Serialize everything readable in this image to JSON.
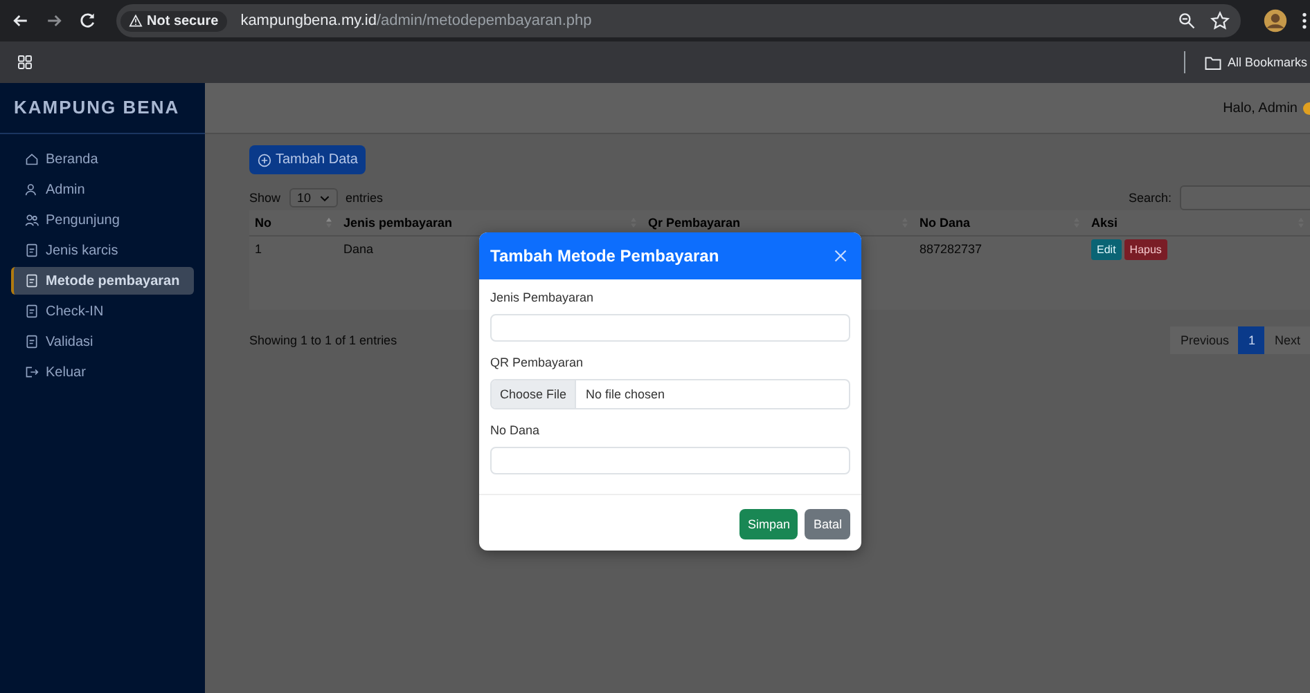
{
  "browser": {
    "security": "Not secure",
    "url_domain": "kampungbena.my.id",
    "url_path": "/admin/metodepembayaran.php",
    "bookmarks": "All Bookmarks"
  },
  "sidebar": {
    "brand": "KAMPUNG BENA",
    "items": [
      {
        "label": "Beranda",
        "selected": false
      },
      {
        "label": "Admin",
        "selected": false
      },
      {
        "label": "Pengunjung",
        "selected": false
      },
      {
        "label": "Jenis karcis",
        "selected": false
      },
      {
        "label": "Metode pembayaran",
        "selected": true
      },
      {
        "label": "Check-IN",
        "selected": false
      },
      {
        "label": "Validasi",
        "selected": false
      },
      {
        "label": "Keluar",
        "selected": false
      }
    ]
  },
  "header": {
    "greeting": "Halo, Admin"
  },
  "add_button": "Tambah Data",
  "table": {
    "show_label": "Show",
    "page_size": "10",
    "entries_label": "entries",
    "search_label": "Search:",
    "columns": [
      "No",
      "Jenis pembayaran",
      "Qr Pembayaran",
      "No Dana",
      "Aksi"
    ],
    "rows": [
      {
        "no": "1",
        "jenis": "Dana",
        "no_dana": "887282737",
        "actions": [
          {
            "label": "Edit",
            "kind": "edit"
          },
          {
            "label": "Hapus",
            "kind": "delete"
          }
        ]
      }
    ],
    "info": "Showing 1 to 1 of 1 entries",
    "pagination": [
      {
        "label": "Previous",
        "selected": false
      },
      {
        "label": "1",
        "selected": true
      },
      {
        "label": "Next",
        "selected": false
      }
    ]
  },
  "modal": {
    "title": "Tambah Metode Pembayaran",
    "fields": [
      {
        "label": "Jenis Pembayaran",
        "kind": "text"
      },
      {
        "label": "QR Pembayaran",
        "kind": "file",
        "button": "Choose File",
        "status": "No file chosen"
      },
      {
        "label": "No Dana",
        "kind": "text"
      }
    ],
    "buttons": [
      {
        "label": "Simpan",
        "kind": "primary"
      },
      {
        "label": "Batal",
        "kind": "secondary"
      }
    ]
  }
}
